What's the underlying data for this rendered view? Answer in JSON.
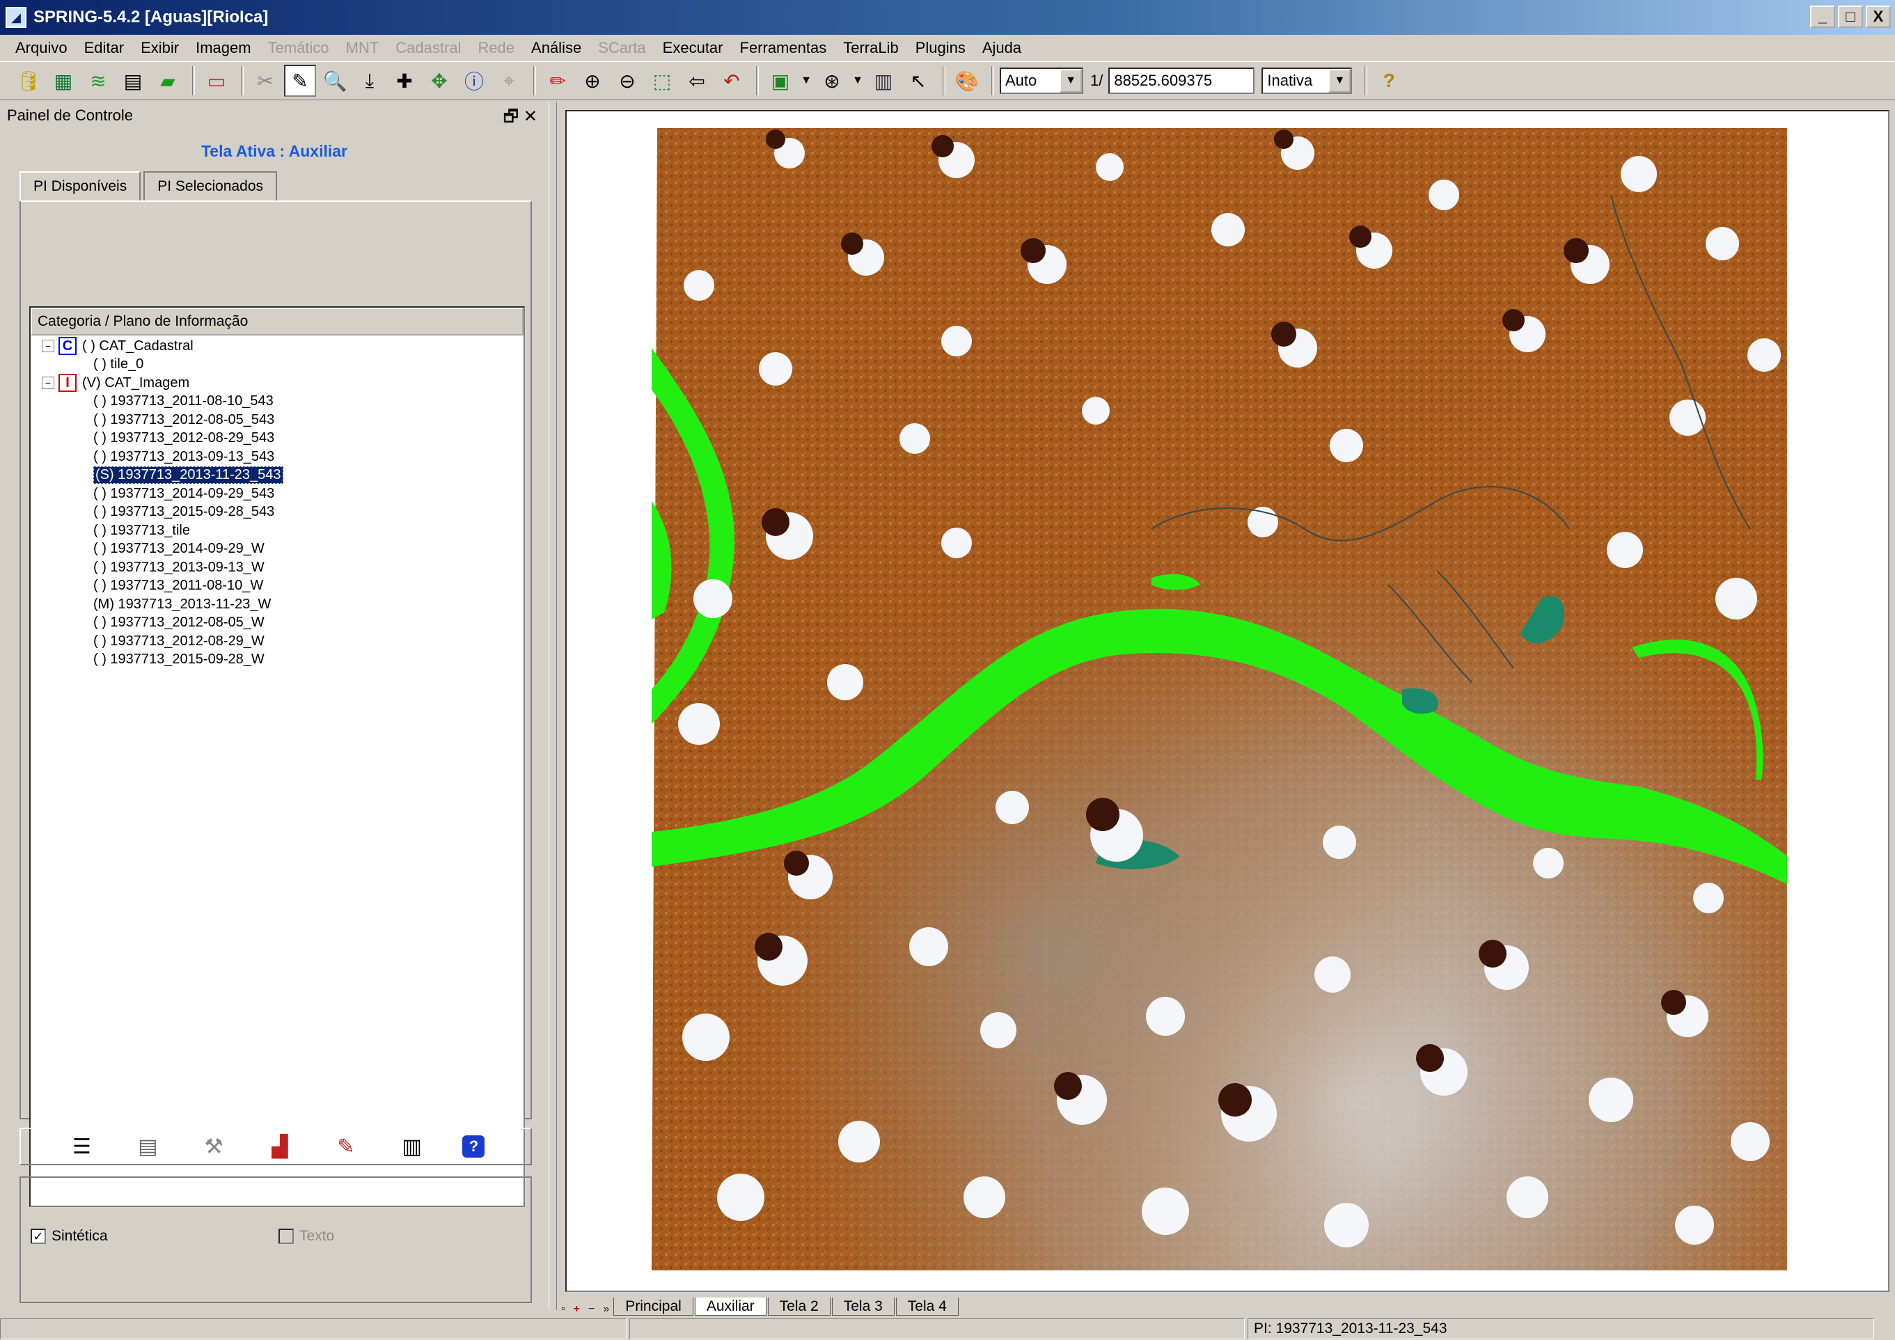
{
  "window": {
    "title": "SPRING-5.4.2 [Aguas][RioIca]",
    "buttons": [
      "_",
      "□",
      "X"
    ]
  },
  "menu": [
    {
      "label": "Arquivo",
      "enabled": true
    },
    {
      "label": "Editar",
      "enabled": true
    },
    {
      "label": "Exibir",
      "enabled": true
    },
    {
      "label": "Imagem",
      "enabled": true
    },
    {
      "label": "Temático",
      "enabled": false
    },
    {
      "label": "MNT",
      "enabled": false
    },
    {
      "label": "Cadastral",
      "enabled": false
    },
    {
      "label": "Rede",
      "enabled": false
    },
    {
      "label": "Análise",
      "enabled": true
    },
    {
      "label": "SCarta",
      "enabled": false
    },
    {
      "label": "Executar",
      "enabled": true
    },
    {
      "label": "Ferramentas",
      "enabled": true
    },
    {
      "label": "TerraLib",
      "enabled": true
    },
    {
      "label": "Plugins",
      "enabled": true
    },
    {
      "label": "Ajuda",
      "enabled": true
    }
  ],
  "toolbar": {
    "scale_mode": "Auto",
    "scale_prefix": "1/",
    "scale_value": "88525.609375",
    "status_mode": "Inativa",
    "help": "?"
  },
  "panel": {
    "title": "Painel de Controle",
    "controls": "🗗 ✕",
    "active_screen": "Tela Ativa : Auxiliar",
    "tabs": [
      "PI Disponíveis",
      "PI Selecionados"
    ],
    "tree_header": "Categoria / Plano de Informação",
    "tree": [
      {
        "label": "( ) CAT_Cadastral",
        "level": 0,
        "icon": "C",
        "type": "category"
      },
      {
        "label": "( ) tile_0",
        "level": 1,
        "type": "leaf"
      },
      {
        "label": "(V) CAT_Imagem",
        "level": 0,
        "icon": "I",
        "type": "category"
      },
      {
        "label": "( ) 1937713_2011-08-10_543",
        "level": 1,
        "type": "leaf"
      },
      {
        "label": "( ) 1937713_2012-08-05_543",
        "level": 1,
        "type": "leaf"
      },
      {
        "label": "( ) 1937713_2012-08-29_543",
        "level": 1,
        "type": "leaf"
      },
      {
        "label": "( ) 1937713_2013-09-13_543",
        "level": 1,
        "type": "leaf"
      },
      {
        "label": "(S) 1937713_2013-11-23_543",
        "level": 1,
        "type": "leaf",
        "selected": true
      },
      {
        "label": "( ) 1937713_2014-09-29_543",
        "level": 1,
        "type": "leaf"
      },
      {
        "label": "( ) 1937713_2015-09-28_543",
        "level": 1,
        "type": "leaf"
      },
      {
        "label": "( ) 1937713_tile",
        "level": 1,
        "type": "leaf"
      },
      {
        "label": "( ) 1937713_2014-09-29_W",
        "level": 1,
        "type": "leaf"
      },
      {
        "label": "( ) 1937713_2013-09-13_W",
        "level": 1,
        "type": "leaf"
      },
      {
        "label": "( ) 1937713_2011-08-10_W",
        "level": 1,
        "type": "leaf"
      },
      {
        "label": "(M) 1937713_2013-11-23_W",
        "level": 1,
        "type": "leaf"
      },
      {
        "label": "( ) 1937713_2012-08-05_W",
        "level": 1,
        "type": "leaf"
      },
      {
        "label": "( ) 1937713_2012-08-29_W",
        "level": 1,
        "type": "leaf"
      },
      {
        "label": "( ) 1937713_2015-09-28_W",
        "level": 1,
        "type": "leaf"
      }
    ],
    "options": {
      "sintetica_label": "Sintética",
      "sintetica_checked": "✓",
      "texto_label": "Texto"
    }
  },
  "screen_tabs": {
    "nav": [
      "▫",
      "+",
      "−",
      "»"
    ],
    "tabs": [
      "Principal",
      "Auxiliar",
      "Tela 2",
      "Tela 3",
      "Tela 4"
    ],
    "active": "Auxiliar"
  },
  "status": {
    "pi": "PI: 1937713_2013-11-23_543"
  },
  "colors": {
    "title_bar": "#0a246a",
    "active_screen_text": "#1a5adf",
    "water_class": "#22ee11",
    "terrain": "#a65a1e",
    "selection": "#0a246a"
  }
}
